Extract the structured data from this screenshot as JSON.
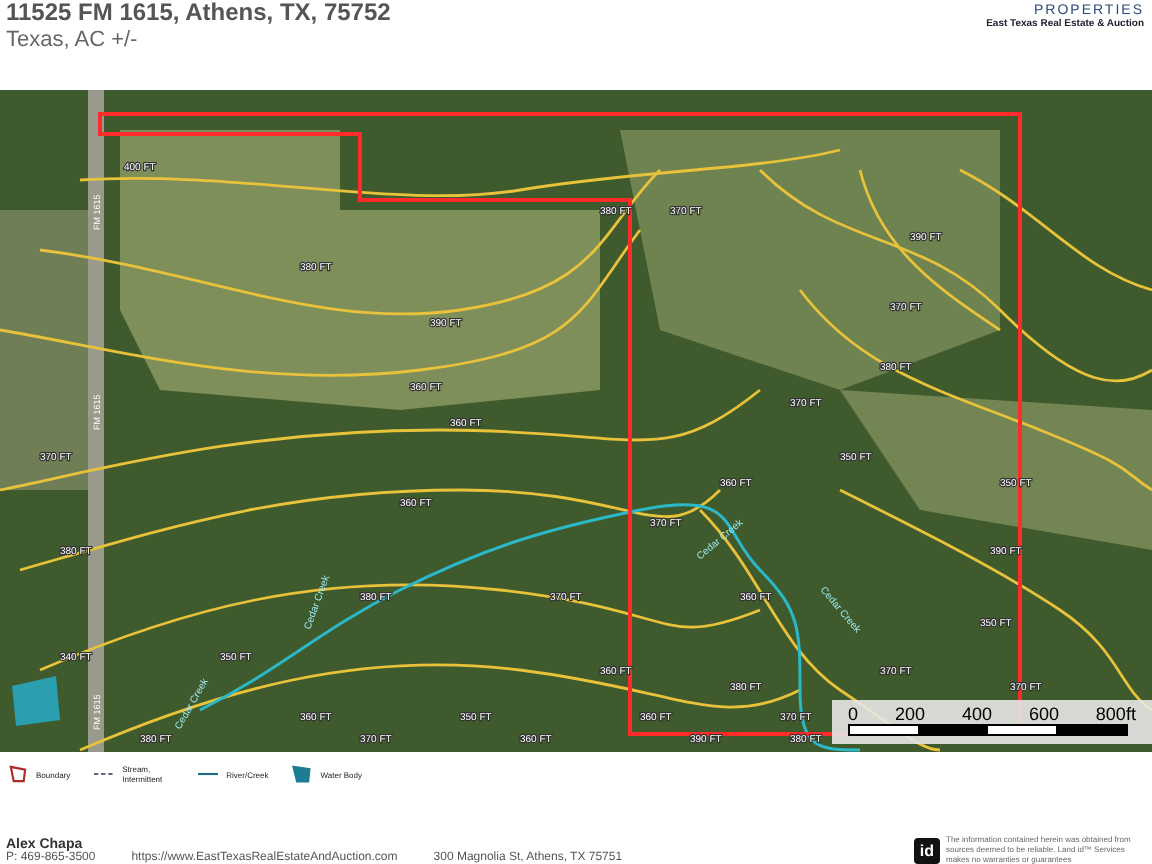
{
  "header": {
    "title": "11525 FM 1615, Athens, TX, 75752",
    "subtitle": "Texas,  AC +/-",
    "logo_word": "PROPERTIES",
    "logo_tagline": "East Texas Real Estate & Auction"
  },
  "map": {
    "road_labels": [
      "FM 1615",
      "FM 1615",
      "FM 1615"
    ],
    "creek_labels": [
      "Cedar Creek",
      "Cedar Creek",
      "Cedar Creek",
      "Cedar Creek"
    ],
    "contour_labels": [
      "400 FT",
      "380 FT",
      "370 FT",
      "390 FT",
      "380 FT",
      "370 FT",
      "390 FT",
      "380 FT",
      "360 FT",
      "370 FT",
      "360 FT",
      "370 FT",
      "350 FT",
      "360 FT",
      "350 FT",
      "360 FT",
      "370 FT",
      "380 FT",
      "390 FT",
      "380 FT",
      "370 FT",
      "360 FT",
      "350 FT",
      "340 FT",
      "350 FT",
      "360 FT",
      "370 FT",
      "380 FT",
      "370 FT",
      "360 FT",
      "350 FT",
      "360 FT",
      "370 FT",
      "380 FT",
      "370 FT",
      "360 FT",
      "390 FT",
      "380 FT"
    ],
    "scale_labels": [
      "0",
      "200",
      "400",
      "600",
      "800ft"
    ]
  },
  "legend": [
    {
      "kind": "boundary",
      "label": "Boundary"
    },
    {
      "kind": "stream",
      "label": "Stream, Intermittent"
    },
    {
      "kind": "river",
      "label": "River/Creek"
    },
    {
      "kind": "water",
      "label": "Water Body"
    }
  ],
  "footer": {
    "agent": "Alex Chapa",
    "phone": "P: 469-865-3500",
    "website": "https://www.EastTexasRealEstateAndAuction.com",
    "address": "300 Magnolia St, Athens, TX 75751",
    "badge": "id",
    "disclaimer": "The information contained herein was obtained from sources deemed to be reliable. Land id™ Services makes no warranties or guarantees"
  }
}
